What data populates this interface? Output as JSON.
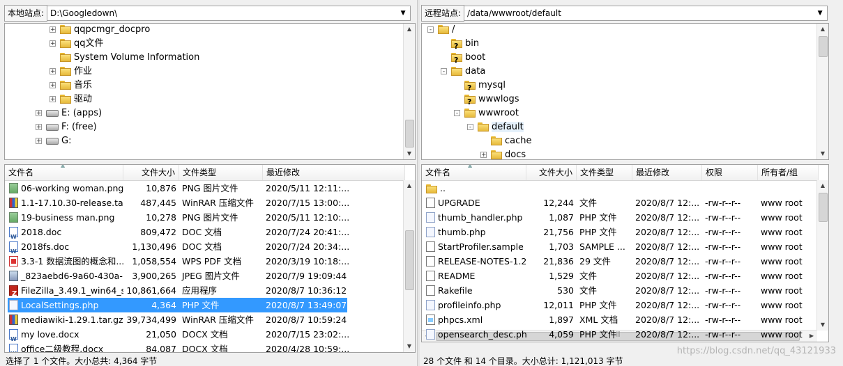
{
  "left": {
    "site_label": "本地站点:",
    "site_path": "D:\\Googledown\\",
    "tree": [
      {
        "label": "qqpcmgr_docpro",
        "icon": "folder-icon",
        "expander": "+"
      },
      {
        "label": "qq文件",
        "icon": "folder-icon",
        "expander": "+"
      },
      {
        "label": "System Volume Information",
        "icon": "folder-icon",
        "expander": ""
      },
      {
        "label": "作业",
        "icon": "folder-icon",
        "expander": "+"
      },
      {
        "label": "音乐",
        "icon": "folder-icon",
        "expander": "+"
      },
      {
        "label": "驱动",
        "icon": "folder-icon",
        "expander": "+"
      },
      {
        "label": "E: (apps)",
        "icon": "drive-icon",
        "expander": "+"
      },
      {
        "label": "F: (free)",
        "icon": "drive-icon",
        "expander": "+"
      },
      {
        "label": "G:",
        "icon": "drive-icon",
        "expander": "+"
      }
    ],
    "columns": [
      "文件名",
      "文件大小",
      "文件类型",
      "最近修改"
    ],
    "files": [
      {
        "name": "06-working woman.png",
        "size": "10,876",
        "type": "PNG 图片文件",
        "modified": "2020/5/11 12:11:...",
        "icon": "png"
      },
      {
        "name": "1.1-17.10.30-release.tar....",
        "size": "487,445",
        "type": "WinRAR 压缩文件",
        "modified": "2020/7/15 13:00:...",
        "icon": "rar"
      },
      {
        "name": "19-business man.png",
        "size": "10,278",
        "type": "PNG 图片文件",
        "modified": "2020/5/11 12:10:...",
        "icon": "png"
      },
      {
        "name": "2018.doc",
        "size": "809,472",
        "type": "DOC 文档",
        "modified": "2020/7/24 20:41:...",
        "icon": "word"
      },
      {
        "name": "2018fs.doc",
        "size": "1,130,496",
        "type": "DOC 文档",
        "modified": "2020/7/24 20:34:...",
        "icon": "word"
      },
      {
        "name": "3.3-1 数据流图的概念和...",
        "size": "1,058,554",
        "type": "WPS PDF 文档",
        "modified": "2020/3/19 10:18:...",
        "icon": "pdf"
      },
      {
        "name": "_823aebd6-9a60-430a-...",
        "size": "3,900,265",
        "type": "JPEG 图片文件",
        "modified": "2020/7/9 19:09:44",
        "icon": "jpg"
      },
      {
        "name": "FileZilla_3.49.1_win64_s...",
        "size": "10,861,664",
        "type": "应用程序",
        "modified": "2020/8/7 10:36:12",
        "icon": "fz"
      },
      {
        "name": "LocalSettings.php",
        "size": "4,364",
        "type": "PHP 文件",
        "modified": "2020/8/7 13:49:07",
        "icon": "php",
        "selected": true
      },
      {
        "name": "mediawiki-1.29.1.tar.gz",
        "size": "39,734,499",
        "type": "WinRAR 压缩文件",
        "modified": "2020/8/7 10:59:24",
        "icon": "rar"
      },
      {
        "name": "my love.docx",
        "size": "21,050",
        "type": "DOCX 文档",
        "modified": "2020/7/15 23:02:...",
        "icon": "word"
      },
      {
        "name": "office二级教程.docx",
        "size": "84,087",
        "type": "DOCX 文档",
        "modified": "2020/4/28 10:59:...",
        "icon": "word"
      }
    ],
    "status": "选择了 1 个文件。大小总共: 4,364 字节"
  },
  "right": {
    "site_label": "远程站点:",
    "site_path": "/data/wwwroot/default",
    "tree": [
      {
        "label": "/",
        "icon": "folder-icon",
        "expander": "-",
        "indent": 0
      },
      {
        "label": "bin",
        "icon": "unknown-folder-icon",
        "expander": "",
        "indent": 1
      },
      {
        "label": "boot",
        "icon": "unknown-folder-icon",
        "expander": "",
        "indent": 1
      },
      {
        "label": "data",
        "icon": "folder-icon",
        "expander": "-",
        "indent": 1
      },
      {
        "label": "mysql",
        "icon": "unknown-folder-icon",
        "expander": "",
        "indent": 2
      },
      {
        "label": "wwwlogs",
        "icon": "unknown-folder-icon",
        "expander": "",
        "indent": 2
      },
      {
        "label": "wwwroot",
        "icon": "folder-icon",
        "expander": "-",
        "indent": 2
      },
      {
        "label": "default",
        "icon": "folder-icon",
        "expander": "-",
        "indent": 3,
        "selected": true
      },
      {
        "label": "cache",
        "icon": "folder-icon",
        "expander": "",
        "indent": 4
      },
      {
        "label": "docs",
        "icon": "folder-icon",
        "expander": "+",
        "indent": 4
      }
    ],
    "columns": [
      "文件名",
      "文件大小",
      "文件类型",
      "最近修改",
      "权限",
      "所有者/组"
    ],
    "files": [
      {
        "name": "..",
        "size": "",
        "type": "",
        "modified": "",
        "perm": "",
        "owner": "",
        "icon": "folder"
      },
      {
        "name": "UPGRADE",
        "size": "12,244",
        "type": "文件",
        "modified": "2020/8/7 12:...",
        "perm": "-rw-r--r--",
        "owner": "www root",
        "icon": "doc"
      },
      {
        "name": "thumb_handler.php",
        "size": "1,087",
        "type": "PHP 文件",
        "modified": "2020/8/7 12:...",
        "perm": "-rw-r--r--",
        "owner": "www root",
        "icon": "php"
      },
      {
        "name": "thumb.php",
        "size": "21,756",
        "type": "PHP 文件",
        "modified": "2020/8/7 12:...",
        "perm": "-rw-r--r--",
        "owner": "www root",
        "icon": "php"
      },
      {
        "name": "StartProfiler.sample",
        "size": "1,703",
        "type": "SAMPLE ...",
        "modified": "2020/8/7 12:...",
        "perm": "-rw-r--r--",
        "owner": "www root",
        "icon": "doc"
      },
      {
        "name": "RELEASE-NOTES-1.29",
        "size": "21,836",
        "type": "29 文件",
        "modified": "2020/8/7 12:...",
        "perm": "-rw-r--r--",
        "owner": "www root",
        "icon": "doc"
      },
      {
        "name": "README",
        "size": "1,529",
        "type": "文件",
        "modified": "2020/8/7 12:...",
        "perm": "-rw-r--r--",
        "owner": "www root",
        "icon": "doc"
      },
      {
        "name": "Rakefile",
        "size": "530",
        "type": "文件",
        "modified": "2020/8/7 12:...",
        "perm": "-rw-r--r--",
        "owner": "www root",
        "icon": "doc"
      },
      {
        "name": "profileinfo.php",
        "size": "12,011",
        "type": "PHP 文件",
        "modified": "2020/8/7 12:...",
        "perm": "-rw-r--r--",
        "owner": "www root",
        "icon": "php"
      },
      {
        "name": "phpcs.xml",
        "size": "1,897",
        "type": "XML 文档",
        "modified": "2020/8/7 12:...",
        "perm": "-rw-r--r--",
        "owner": "www root",
        "icon": "xml"
      },
      {
        "name": "opensearch_desc.php",
        "size": "4,059",
        "type": "PHP 文件",
        "modified": "2020/8/7 12:...",
        "perm": "-rw-r--r--",
        "owner": "www root",
        "icon": "php"
      }
    ],
    "status": "28 个文件 和 14 个目录。大小总计: 1,121,013 字节"
  },
  "watermark": "https://blog.csdn.net/qq_43121933",
  "colors": {
    "selection": "#3399ff",
    "folder": "#f0c850"
  }
}
